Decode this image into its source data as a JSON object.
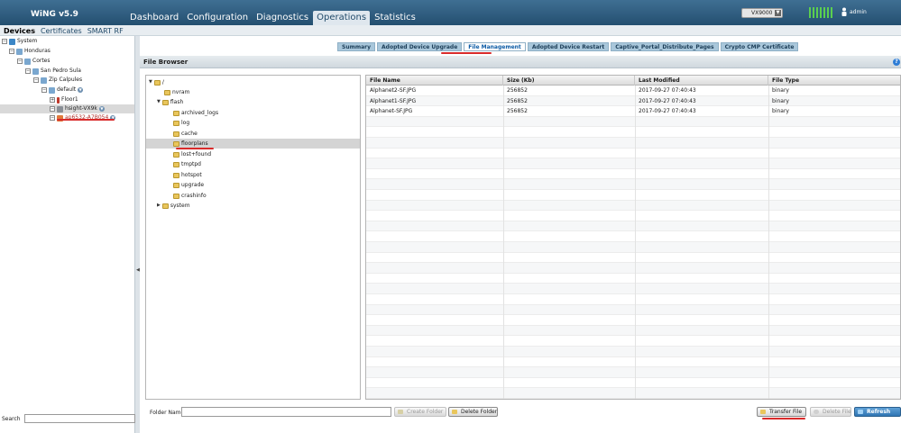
{
  "app": {
    "logo": "WiNG v5.9",
    "nav": [
      "Dashboard",
      "Configuration",
      "Diagnostics",
      "Operations",
      "Statistics"
    ],
    "active_nav": "Operations",
    "device_select": "VX9000",
    "user": "admin"
  },
  "left": {
    "tabs": [
      "Devices",
      "Certificates",
      "SMART RF"
    ],
    "active_tab": "Devices",
    "tree": [
      {
        "label": "System",
        "icon": "globe-icon",
        "level": 0
      },
      {
        "label": "Honduras",
        "icon": "location-icon",
        "level": 1
      },
      {
        "label": "Cortes",
        "icon": "location-icon",
        "level": 2
      },
      {
        "label": "San Pedro Sula",
        "icon": "location-icon",
        "level": 3
      },
      {
        "label": "Zip Calpules",
        "icon": "location-icon",
        "level": 4
      },
      {
        "label": "default",
        "icon": "site-icon",
        "level": 5
      },
      {
        "label": "Floor1",
        "icon": "floor-icon",
        "level": 6
      },
      {
        "label": "hsight-VX9k",
        "icon": "controller-icon",
        "level": 6
      },
      {
        "label": "ap6532-A7B054",
        "icon": "access-point-icon",
        "level": 6
      }
    ],
    "search_label": "Search"
  },
  "subtabs": [
    "Summary",
    "Adopted Device Upgrade",
    "File Management",
    "Adopted Device Restart",
    "Captive_Portal_Distribute_Pages",
    "Crypto CMP Certificate"
  ],
  "active_subtab": "File Management",
  "file_browser": {
    "title": "File Browser",
    "tree": [
      {
        "label": "/",
        "level": 0,
        "expanded": true
      },
      {
        "label": "nvram",
        "level": 1
      },
      {
        "label": "flash",
        "level": 1,
        "expanded": true
      },
      {
        "label": "archived_logs",
        "level": 2
      },
      {
        "label": "log",
        "level": 2
      },
      {
        "label": "cache",
        "level": 2
      },
      {
        "label": "floorplans",
        "level": 2,
        "selected": true
      },
      {
        "label": "lost+found",
        "level": 2
      },
      {
        "label": "tmptpd",
        "level": 2
      },
      {
        "label": "hotspot",
        "level": 2
      },
      {
        "label": "upgrade",
        "level": 2
      },
      {
        "label": "crashinfo",
        "level": 2
      },
      {
        "label": "system",
        "level": 1,
        "collapsed": true
      }
    ],
    "columns": [
      "File Name",
      "Size (Kb)",
      "Last Modified",
      "File Type"
    ],
    "rows": [
      [
        "Alphanet2-SF.JPG",
        "256852",
        "2017-09-27 07:40:43",
        "binary"
      ],
      [
        "Alphanet1-SF.JPG",
        "256852",
        "2017-09-27 07:40:43",
        "binary"
      ],
      [
        "Alphanet-SF.JPG",
        "256852",
        "2017-09-27 07:40:43",
        "binary"
      ]
    ]
  },
  "bottom": {
    "folder_name_label": "Folder Name",
    "create_folder": "Create Folder",
    "delete_folder": "Delete Folder",
    "transfer_file": "Transfer File",
    "delete_file": "Delete File",
    "refresh": "Refresh"
  }
}
